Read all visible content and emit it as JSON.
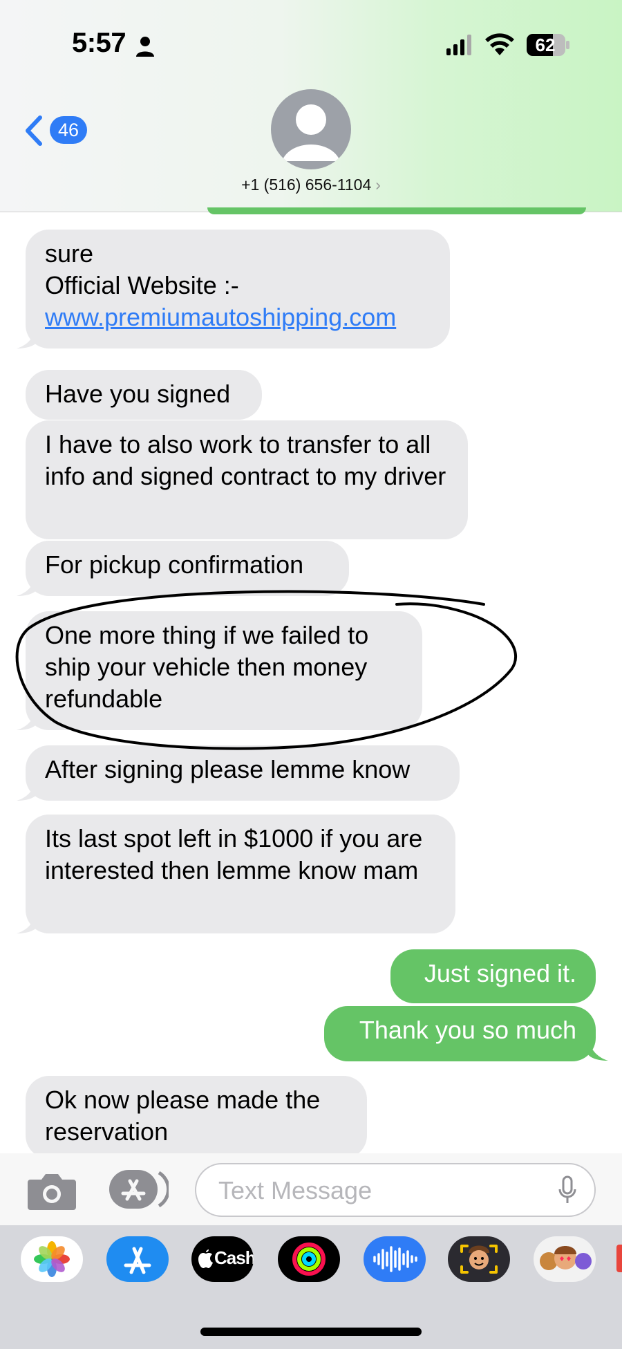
{
  "status_bar": {
    "time": "5:57",
    "battery": "62",
    "icons": [
      "person-icon",
      "signal-icon",
      "wifi-icon",
      "battery-icon"
    ]
  },
  "header": {
    "back_count": "46",
    "contact": "+1 (516) 656-1104",
    "contact_chevron": "›",
    "avatar_icon": "contact-avatar-icon"
  },
  "messages": [
    {
      "from": "them",
      "lines": [
        "sure",
        "Official Website :-"
      ],
      "link": "www.premiumautoshipping.com"
    },
    {
      "from": "them",
      "text": "Have you signed"
    },
    {
      "from": "them",
      "text": "I have to also work to transfer to all info and signed contract to my driver"
    },
    {
      "from": "them",
      "text": "For pickup confirmation"
    },
    {
      "from": "them",
      "text": "One more thing if we failed to ship your vehicle then money refundable",
      "annotated": true
    },
    {
      "from": "them",
      "text": "After signing please lemme know"
    },
    {
      "from": "them",
      "text": "Its last spot left in $1000 if you are interested then lemme know mam"
    },
    {
      "from": "me",
      "text": "Just signed it."
    },
    {
      "from": "me",
      "text": "Thank you so much"
    },
    {
      "from": "them",
      "text": "Ok now please made the reservation"
    }
  ],
  "composer": {
    "placeholder": "Text Message",
    "camera_icon": "camera-icon",
    "apps_icon": "app-store-icon",
    "mic_icon": "microphone-icon"
  },
  "app_drawer": [
    {
      "name": "photos-app-icon"
    },
    {
      "name": "app-store-app-icon"
    },
    {
      "name": "apple-cash-app-icon",
      "label": "Cash"
    },
    {
      "name": "activity-app-icon"
    },
    {
      "name": "audio-message-app-icon"
    },
    {
      "name": "memoji-app-icon"
    },
    {
      "name": "memoji-stickers-app-icon"
    }
  ],
  "colors": {
    "incoming_bubble": "#e9e9eb",
    "outgoing_bubble": "#65c466",
    "link": "#2f7cf6",
    "badge": "#2f7cf6",
    "annotation_ink": "#000000"
  }
}
